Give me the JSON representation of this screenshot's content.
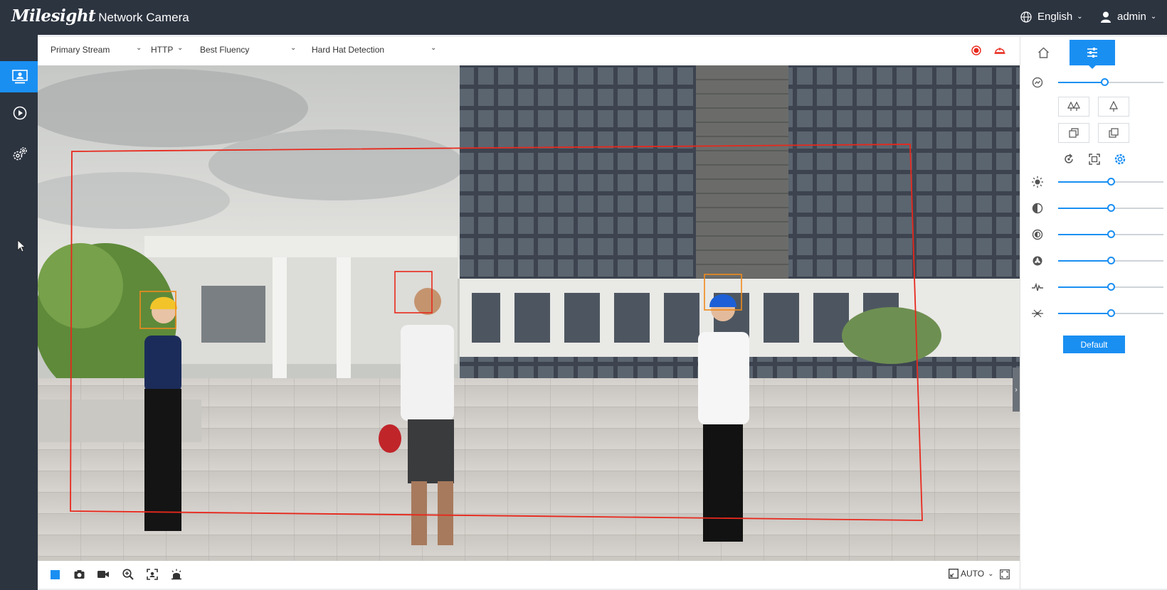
{
  "header": {
    "brand": "Milesight",
    "product": "Network Camera",
    "language": "English",
    "user": "admin"
  },
  "toolbar": {
    "stream": "Primary Stream",
    "protocol": "HTTP",
    "fluency": "Best Fluency",
    "detection": "Hard Hat Detection"
  },
  "bottombar": {
    "zoom_mode": "AUTO"
  },
  "panel": {
    "default_label": "Default",
    "sliders": [
      {
        "name": "zoom",
        "icon": "zoom-icon",
        "value": 0.44
      },
      {
        "name": "brightness",
        "icon": "brightness-icon",
        "value": 0.5
      },
      {
        "name": "contrast",
        "icon": "contrast-icon",
        "value": 0.5
      },
      {
        "name": "saturation",
        "icon": "saturation-icon",
        "value": 0.5
      },
      {
        "name": "sharpness",
        "icon": "sharpness-icon",
        "value": 0.5
      },
      {
        "name": "wave",
        "icon": "sharpness-wave-icon",
        "value": 0.5
      },
      {
        "name": "noise",
        "icon": "noise-reduction-icon",
        "value": 0.5
      }
    ]
  },
  "colors": {
    "accent": "#1a8ff2",
    "topbar": "#2c3440",
    "detection_region": "#e8281c",
    "detection_box": "#f08a1c"
  }
}
